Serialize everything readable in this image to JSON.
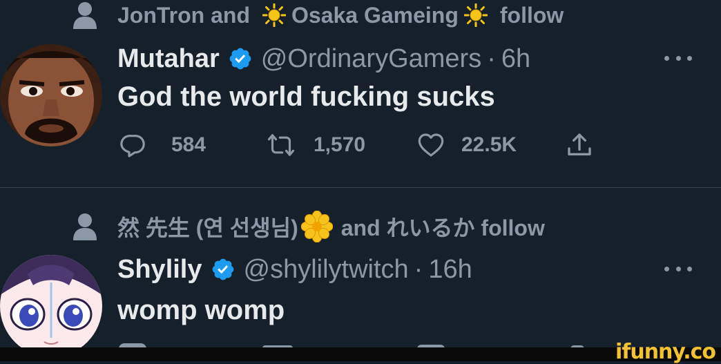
{
  "colors": {
    "background": "#15202b",
    "primary_text": "#e7e9ea",
    "secondary_text": "#8b98a5",
    "verified_blue": "#1d9bf0",
    "divider": "#38444d",
    "brand": "#f2c230"
  },
  "tweet1": {
    "social_context": {
      "part1": "JonTron and",
      "part2": "Osaka Gameing",
      "part3": "follow",
      "icon": "sun-emoji"
    },
    "author": {
      "name": "Mutahar",
      "handle": "@OrdinaryGamers",
      "dot": "·",
      "time": "6h",
      "verified": true
    },
    "text": "God the world fucking sucks",
    "actions": {
      "replies": "584",
      "retweets": "1,570",
      "likes": "22.5K"
    }
  },
  "tweet2": {
    "social_context": {
      "part1": "然 先生 (연 선생님)",
      "part2": "and れいるか follow",
      "icon": "flower-emoji"
    },
    "author": {
      "name": "Shylily",
      "handle": "@shylilytwitch",
      "dot": "·",
      "time": "16h",
      "verified": true
    },
    "text": "womp womp"
  },
  "watermark": {
    "brand": "ifunny.co"
  }
}
